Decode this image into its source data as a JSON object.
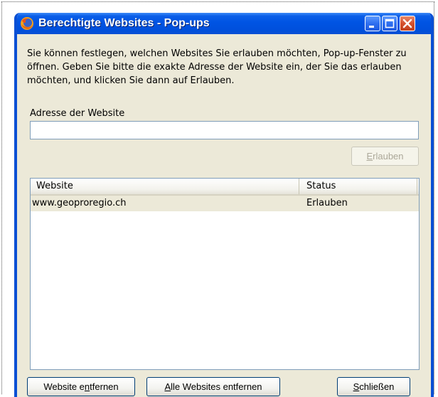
{
  "window": {
    "title": "Berechtigte Websites - Pop-ups",
    "app_icon": "firefox-icon",
    "controls": {
      "minimize_icon": "minimize-icon",
      "maximize_icon": "maximize-icon",
      "close_icon": "close-icon"
    }
  },
  "intro_text": "Sie können festlegen, welchen Websites Sie erlauben möchten, Pop-up-Fenster zu öffnen. Geben Sie bitte die exakte Adresse der Website ein, der Sie das erlauben möchten, und klicken Sie dann auf Erlauben.",
  "address": {
    "label": "Adresse der Website",
    "value": ""
  },
  "allow_button": {
    "accel": "E",
    "rest": "rlauben",
    "disabled": true
  },
  "list": {
    "columns": [
      "Website",
      "Status"
    ],
    "rows": [
      {
        "website": "www.geoproregio.ch",
        "status": "Erlauben"
      }
    ]
  },
  "buttons": {
    "remove": {
      "pre": "Website e",
      "accel": "n",
      "post": "tfernen"
    },
    "remove_all": {
      "pre": "",
      "accel": "A",
      "post": "lle Websites entfernen"
    },
    "close": {
      "pre": "",
      "accel": "S",
      "post": "chließen"
    }
  },
  "colors": {
    "titlebar": "#0054e3",
    "dialog_bg": "#ece9d8",
    "selected_row": "#ece9d8"
  }
}
